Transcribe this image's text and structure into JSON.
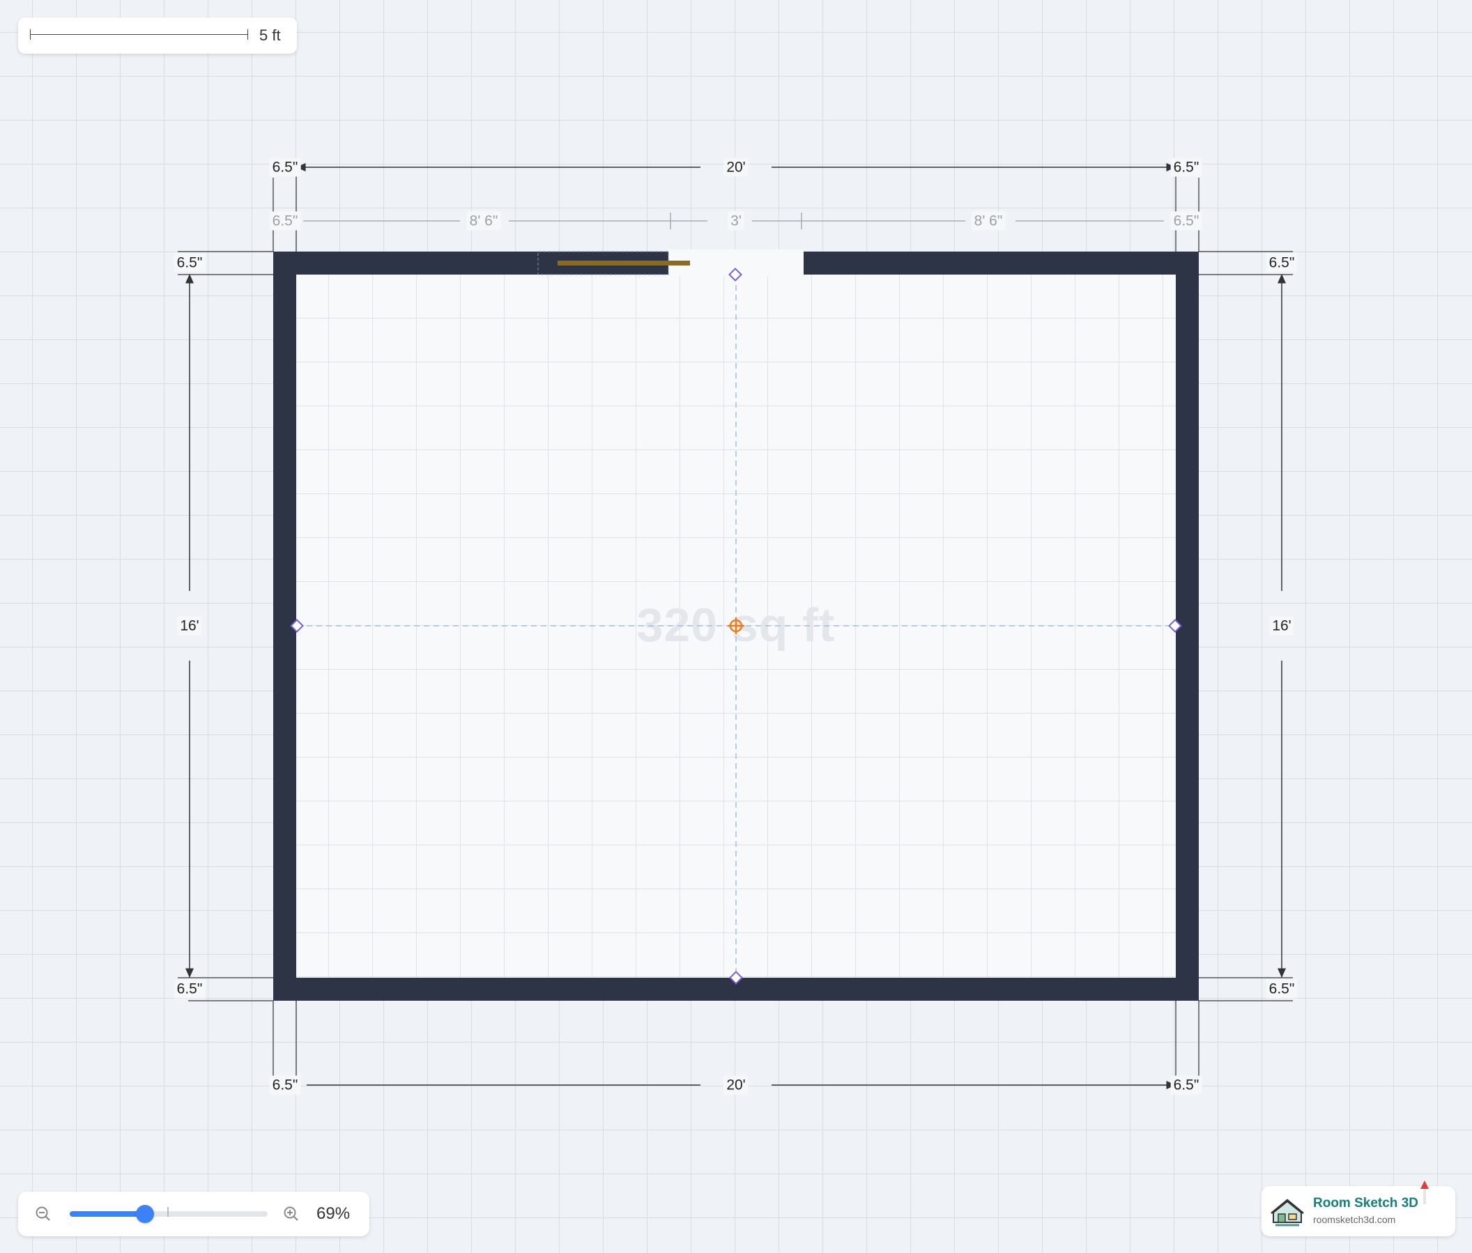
{
  "scale": {
    "label": "5 ft"
  },
  "room": {
    "area": "320 sq ft"
  },
  "dimensions": {
    "top_overall": {
      "left": "6.5\"",
      "center": "20'",
      "right": "6.5\""
    },
    "top_segments": {
      "left_end": "6.5\"",
      "left": "8' 6\"",
      "door": "3'",
      "right": "8' 6\"",
      "right_end": "6.5\""
    },
    "bottom_overall": {
      "left": "6.5\"",
      "center": "20'",
      "right": "6.5\""
    },
    "left_side": {
      "top": "6.5\"",
      "center": "16'",
      "bottom": "6.5\""
    },
    "right_side": {
      "top": "6.5\"",
      "center": "16'",
      "bottom": "6.5\""
    }
  },
  "zoom": {
    "value": "69%",
    "level": 0.38
  },
  "brand": {
    "name": "Room Sketch 3D",
    "url": "roomsketch3d.com"
  },
  "colors": {
    "wall": "#2c3445",
    "door": "#8a6a22",
    "accent": "#3b82f6",
    "handle": "#7a5cd6",
    "center": "#f07a1a"
  }
}
